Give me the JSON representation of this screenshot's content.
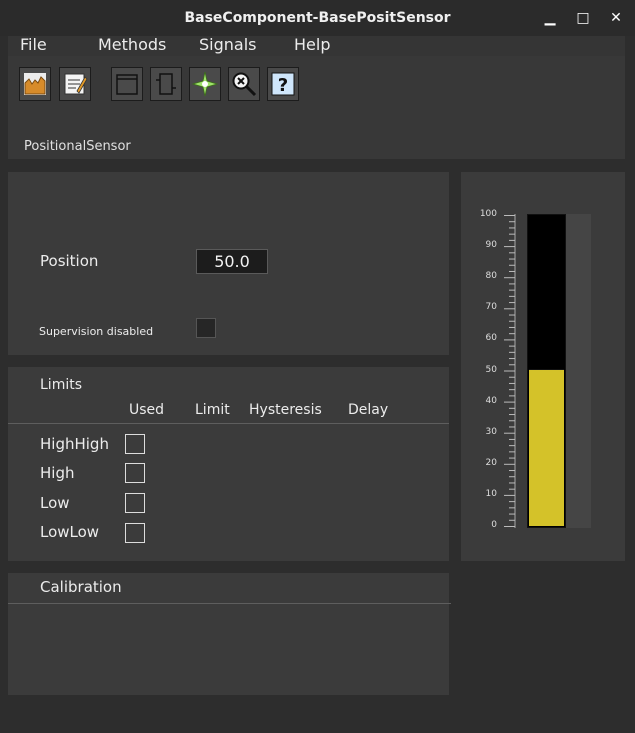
{
  "window": {
    "title": "BaseComponent-BasePositSensor",
    "minimize": "▁",
    "maximize": "□",
    "close": "✕"
  },
  "menu": [
    "File",
    "Methods",
    "Signals",
    "Help"
  ],
  "toolbar": {
    "icons": [
      "trend-icon",
      "edit-icon",
      "window-icon",
      "component-icon",
      "spark-icon",
      "zoom-search-icon",
      "help-icon"
    ],
    "help_glyph": "?"
  },
  "object_name": "PositionalSensor",
  "main": {
    "position_label": "Position",
    "position_value": "50.0",
    "supervision_label": "Supervision disabled",
    "supervision_disabled": false
  },
  "limits": {
    "title": "Limits",
    "columns": [
      "Used",
      "Limit",
      "Hysteresis",
      "Delay"
    ],
    "rows": [
      {
        "name": "HighHigh",
        "used": false
      },
      {
        "name": "High",
        "used": false
      },
      {
        "name": "Low",
        "used": false
      },
      {
        "name": "LowLow",
        "used": false
      }
    ]
  },
  "calibration": {
    "title": "Calibration"
  },
  "gauge": {
    "min": 0,
    "max": 100,
    "value": 50,
    "tick_labels": [
      "100",
      "90",
      "80",
      "70",
      "60",
      "50",
      "40",
      "30",
      "20",
      "10",
      "0"
    ],
    "fill_color": "#d4c229",
    "background_color": "#000000"
  }
}
